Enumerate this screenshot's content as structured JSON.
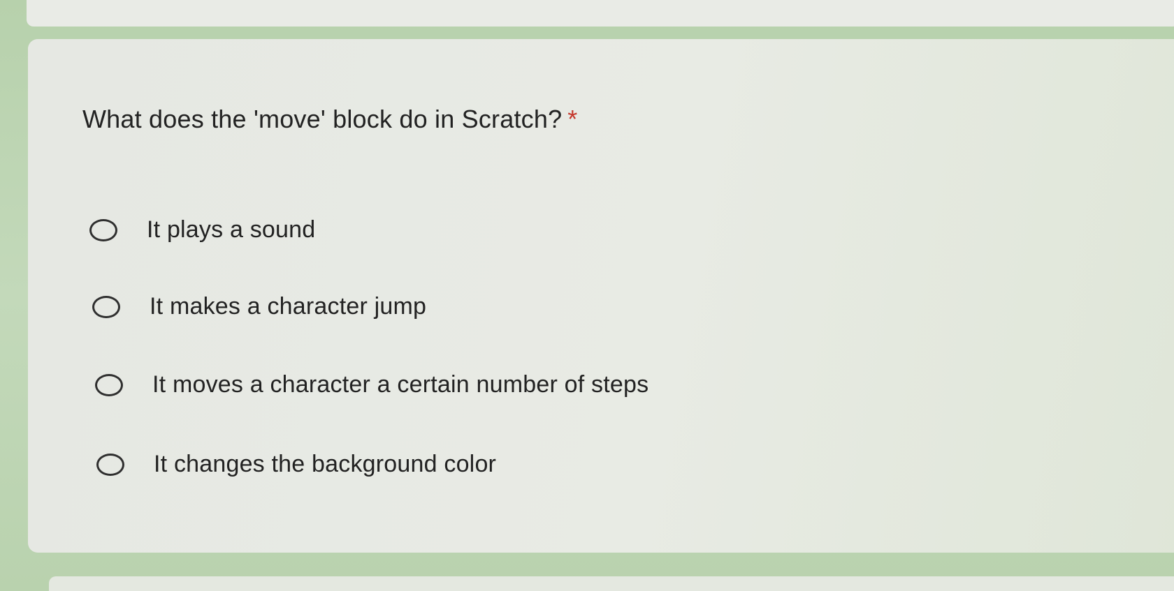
{
  "question": {
    "text": "What does the 'move' block do in Scratch?",
    "required_marker": "*"
  },
  "options": [
    {
      "label": "It plays a sound"
    },
    {
      "label": "It makes a character jump"
    },
    {
      "label": "It moves a character a certain number of steps"
    },
    {
      "label": "It changes the background color"
    }
  ],
  "colors": {
    "page_background": "#bfd6b5",
    "card_background": "#e7eae4",
    "required_marker": "#c5372b",
    "text": "#222222"
  }
}
